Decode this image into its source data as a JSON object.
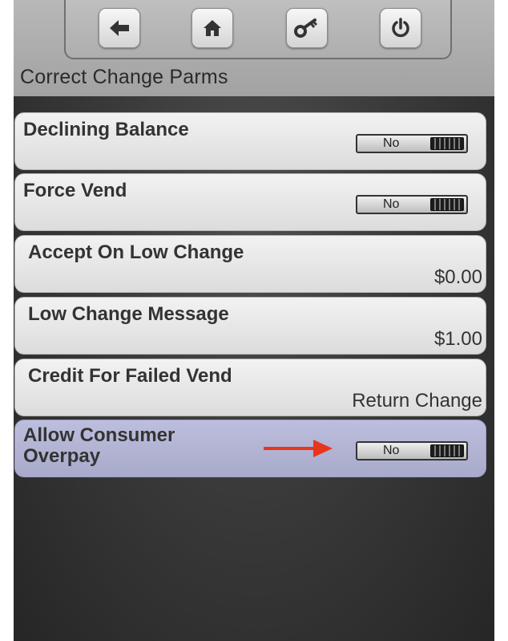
{
  "header": {
    "title": "Correct Change Parms",
    "buttons": [
      {
        "name": "back",
        "icon": "back-arrow-icon"
      },
      {
        "name": "home",
        "icon": "home-icon"
      },
      {
        "name": "key",
        "icon": "key-icon"
      },
      {
        "name": "power",
        "icon": "power-icon"
      }
    ]
  },
  "settings": [
    {
      "label": "Declining Balance",
      "toggle": "No"
    },
    {
      "label": "Force Vend",
      "toggle": "No"
    },
    {
      "label": "Accept On Low Change",
      "value": "$0.00"
    },
    {
      "label": "Low Change Message",
      "value": "$1.00"
    },
    {
      "label": "Credit For Failed Vend",
      "value": "Return Change"
    },
    {
      "label": "Allow Consumer\nOverpay",
      "toggle": "No",
      "highlighted": true
    }
  ],
  "colors": {
    "annotation_arrow": "#e8361c",
    "highlight_row": "#b3b4d4"
  }
}
